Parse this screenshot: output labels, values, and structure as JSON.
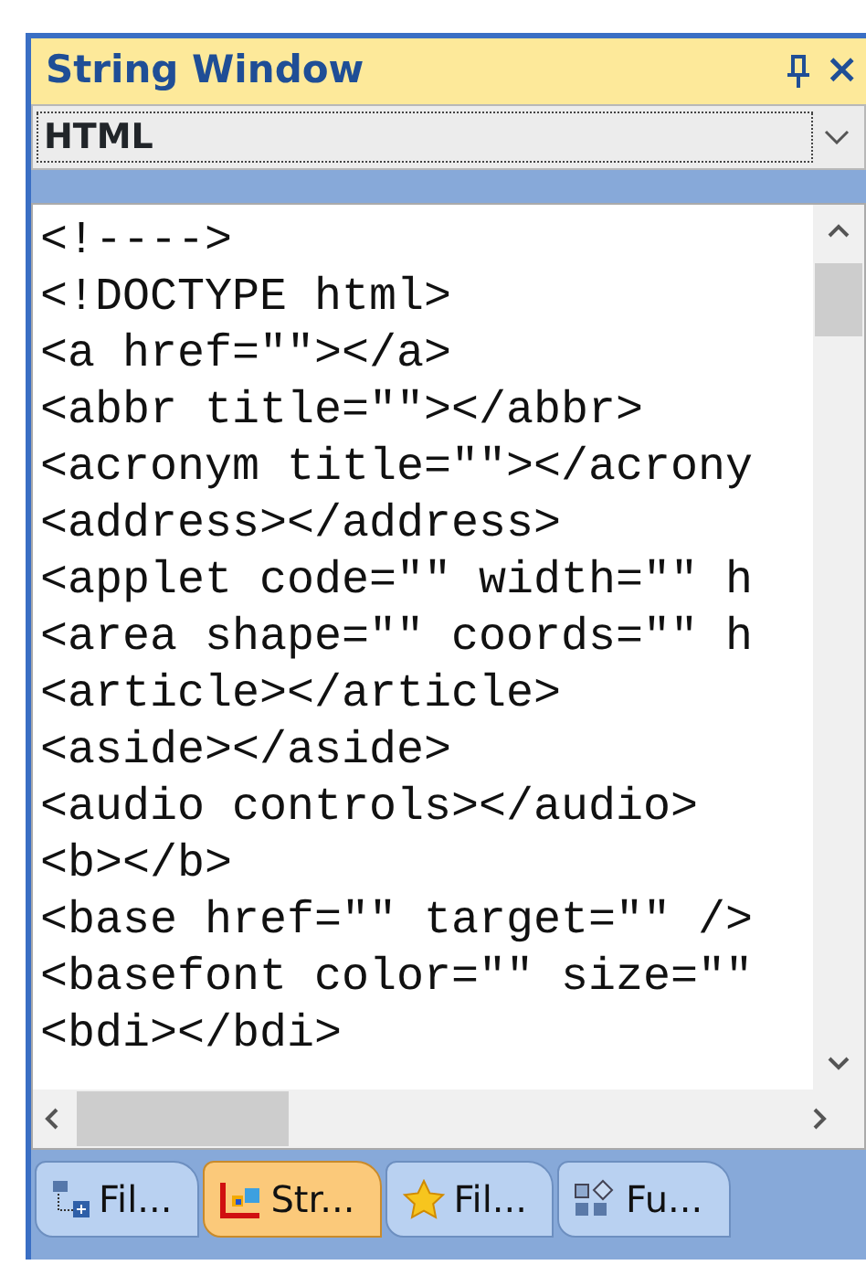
{
  "window": {
    "title": "String Window",
    "close": "×"
  },
  "dropdown": {
    "value": "HTML"
  },
  "list": {
    "items": [
      "<!---->",
      "<!DOCTYPE html>",
      "<a href=\"\"></a>",
      "<abbr title=\"\"></abbr>",
      "<acronym title=\"\"></acrony",
      "<address></address>",
      "<applet code=\"\" width=\"\" h",
      "<area shape=\"\" coords=\"\" h",
      "<article></article>",
      "<aside></aside>",
      "<audio controls></audio>",
      "<b></b>",
      "<base href=\"\" target=\"\" />",
      "<basefont color=\"\" size=\"\"",
      "<bdi></bdi>"
    ]
  },
  "tabs": [
    {
      "label": "Fil...",
      "selected": false
    },
    {
      "label": "Str...",
      "selected": true
    },
    {
      "label": "Fil...",
      "selected": false
    },
    {
      "label": "Fu...",
      "selected": false
    }
  ]
}
